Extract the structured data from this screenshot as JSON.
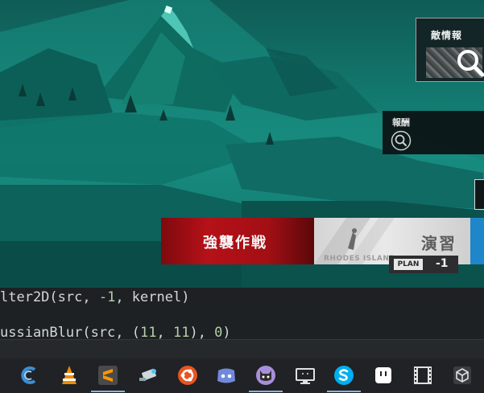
{
  "game": {
    "enemy_info_label": "敵情報",
    "report_label": "報酬",
    "assault_label": "強襲作戦",
    "drill_label": "演習",
    "drill_subtext": "RHODES ISLAND",
    "plan_label": "PLAN",
    "plan_cost": "-1",
    "icons": {
      "enemy_search": "magnifier-icon",
      "report_search": "magnifier-circle-icon"
    },
    "colors": {
      "assault_red": "#b51118",
      "drill_blue": "#1f86c9",
      "terrain_teal": "#16857a"
    }
  },
  "editor": {
    "line1": {
      "prefix": "lter2D(src, ",
      "num1": "-1",
      "suffix": ", kernel)"
    },
    "line2": {
      "prefix": "ussianBlur(src, (",
      "num1": "11",
      "sep": ", ",
      "num2": "11",
      "mid": "), ",
      "num3": "0",
      "suffix": ")"
    }
  },
  "taskbar": {
    "items": [
      {
        "icon": "ccleaner-icon",
        "color": "#3a8fd6",
        "active": false
      },
      {
        "icon": "vlc-icon",
        "color": "#f08a00",
        "active": false
      },
      {
        "icon": "sublime-text-icon",
        "color": "#ff9800",
        "active": true
      },
      {
        "icon": "remote-desktop-icon",
        "color": "#cfd8dc",
        "active": false
      },
      {
        "icon": "ubuntu-icon",
        "color": "#e95420",
        "active": false
      },
      {
        "icon": "discord-icon",
        "color": "#7289da",
        "active": false
      },
      {
        "icon": "github-desktop-icon",
        "color": "#a98fd9",
        "active": true
      },
      {
        "icon": "vmware-icon",
        "color": "#e0e0e0",
        "active": false
      },
      {
        "icon": "skype-icon",
        "color": "#00aff0",
        "active": true
      },
      {
        "icon": "emulator-icon",
        "color": "#ffffff",
        "active": false
      },
      {
        "icon": "film-strip-icon",
        "color": "#e0e0e0",
        "active": false
      },
      {
        "icon": "unity-icon",
        "color": "#e0e0e0",
        "active": false
      }
    ]
  }
}
